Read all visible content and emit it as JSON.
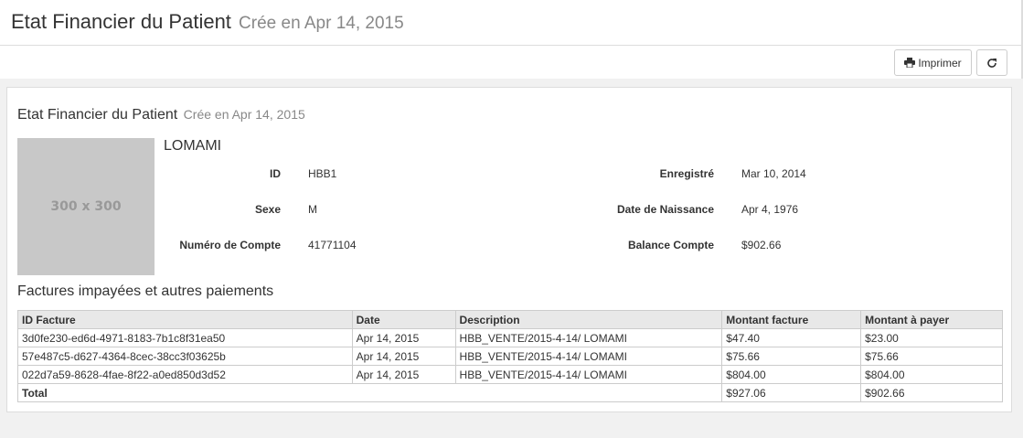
{
  "header": {
    "title": "Etat Financier du Patient",
    "subtitle": "Crée en Apr 14, 2015"
  },
  "toolbar": {
    "print_label": "Imprimer",
    "print_icon": "printer-icon",
    "refresh_icon": "refresh-icon"
  },
  "report": {
    "title": "Etat Financier du Patient",
    "subtitle": "Crée en Apr 14, 2015",
    "avatar_placeholder": "300 x 300",
    "patient_name": "LOMAMI",
    "fields": {
      "id_label": "ID",
      "id_value": "HBB1",
      "sex_label": "Sexe",
      "sex_value": "M",
      "account_label": "Numéro de Compte",
      "account_value": "41771104",
      "registered_label": "Enregistré",
      "registered_value": "Mar 10, 2014",
      "dob_label": "Date de Naissance",
      "dob_value": "Apr 4, 1976",
      "balance_label": "Balance Compte",
      "balance_value": "$902.66"
    },
    "section_title": "Factures impayées et autres paiements",
    "table": {
      "headers": [
        "ID Facture",
        "Date",
        "Description",
        "Montant facture",
        "Montant à payer"
      ],
      "rows": [
        [
          "3d0fe230-ed6d-4971-8183-7b1c8f31ea50",
          "Apr 14, 2015",
          "HBB_VENTE/2015-4-14/ LOMAMI",
          "$47.40",
          "$23.00"
        ],
        [
          "57e487c5-d627-4364-8cec-38cc3f03625b",
          "Apr 14, 2015",
          "HBB_VENTE/2015-4-14/ LOMAMI",
          "$75.66",
          "$75.66"
        ],
        [
          "022d7a59-8628-4fae-8f22-a0ed850d3d52",
          "Apr 14, 2015",
          "HBB_VENTE/2015-4-14/ LOMAMI",
          "$804.00",
          "$804.00"
        ]
      ],
      "total_label": "Total",
      "total_invoice": "$927.06",
      "total_due": "$902.66"
    }
  }
}
